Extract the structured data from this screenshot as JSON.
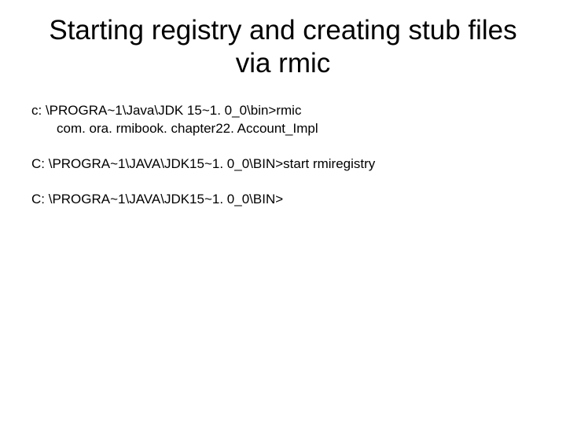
{
  "title": "Starting registry and creating stub files via rmic",
  "lines": {
    "l1": "c: \\PROGRA~1\\Java\\JDK 15~1. 0_0\\bin>rmic",
    "l2": "com. ora. rmibook. chapter22. Account_Impl",
    "l3": "C: \\PROGRA~1\\JAVA\\JDK15~1. 0_0\\BIN>start rmiregistry",
    "l4": "C: \\PROGRA~1\\JAVA\\JDK15~1. 0_0\\BIN>"
  }
}
